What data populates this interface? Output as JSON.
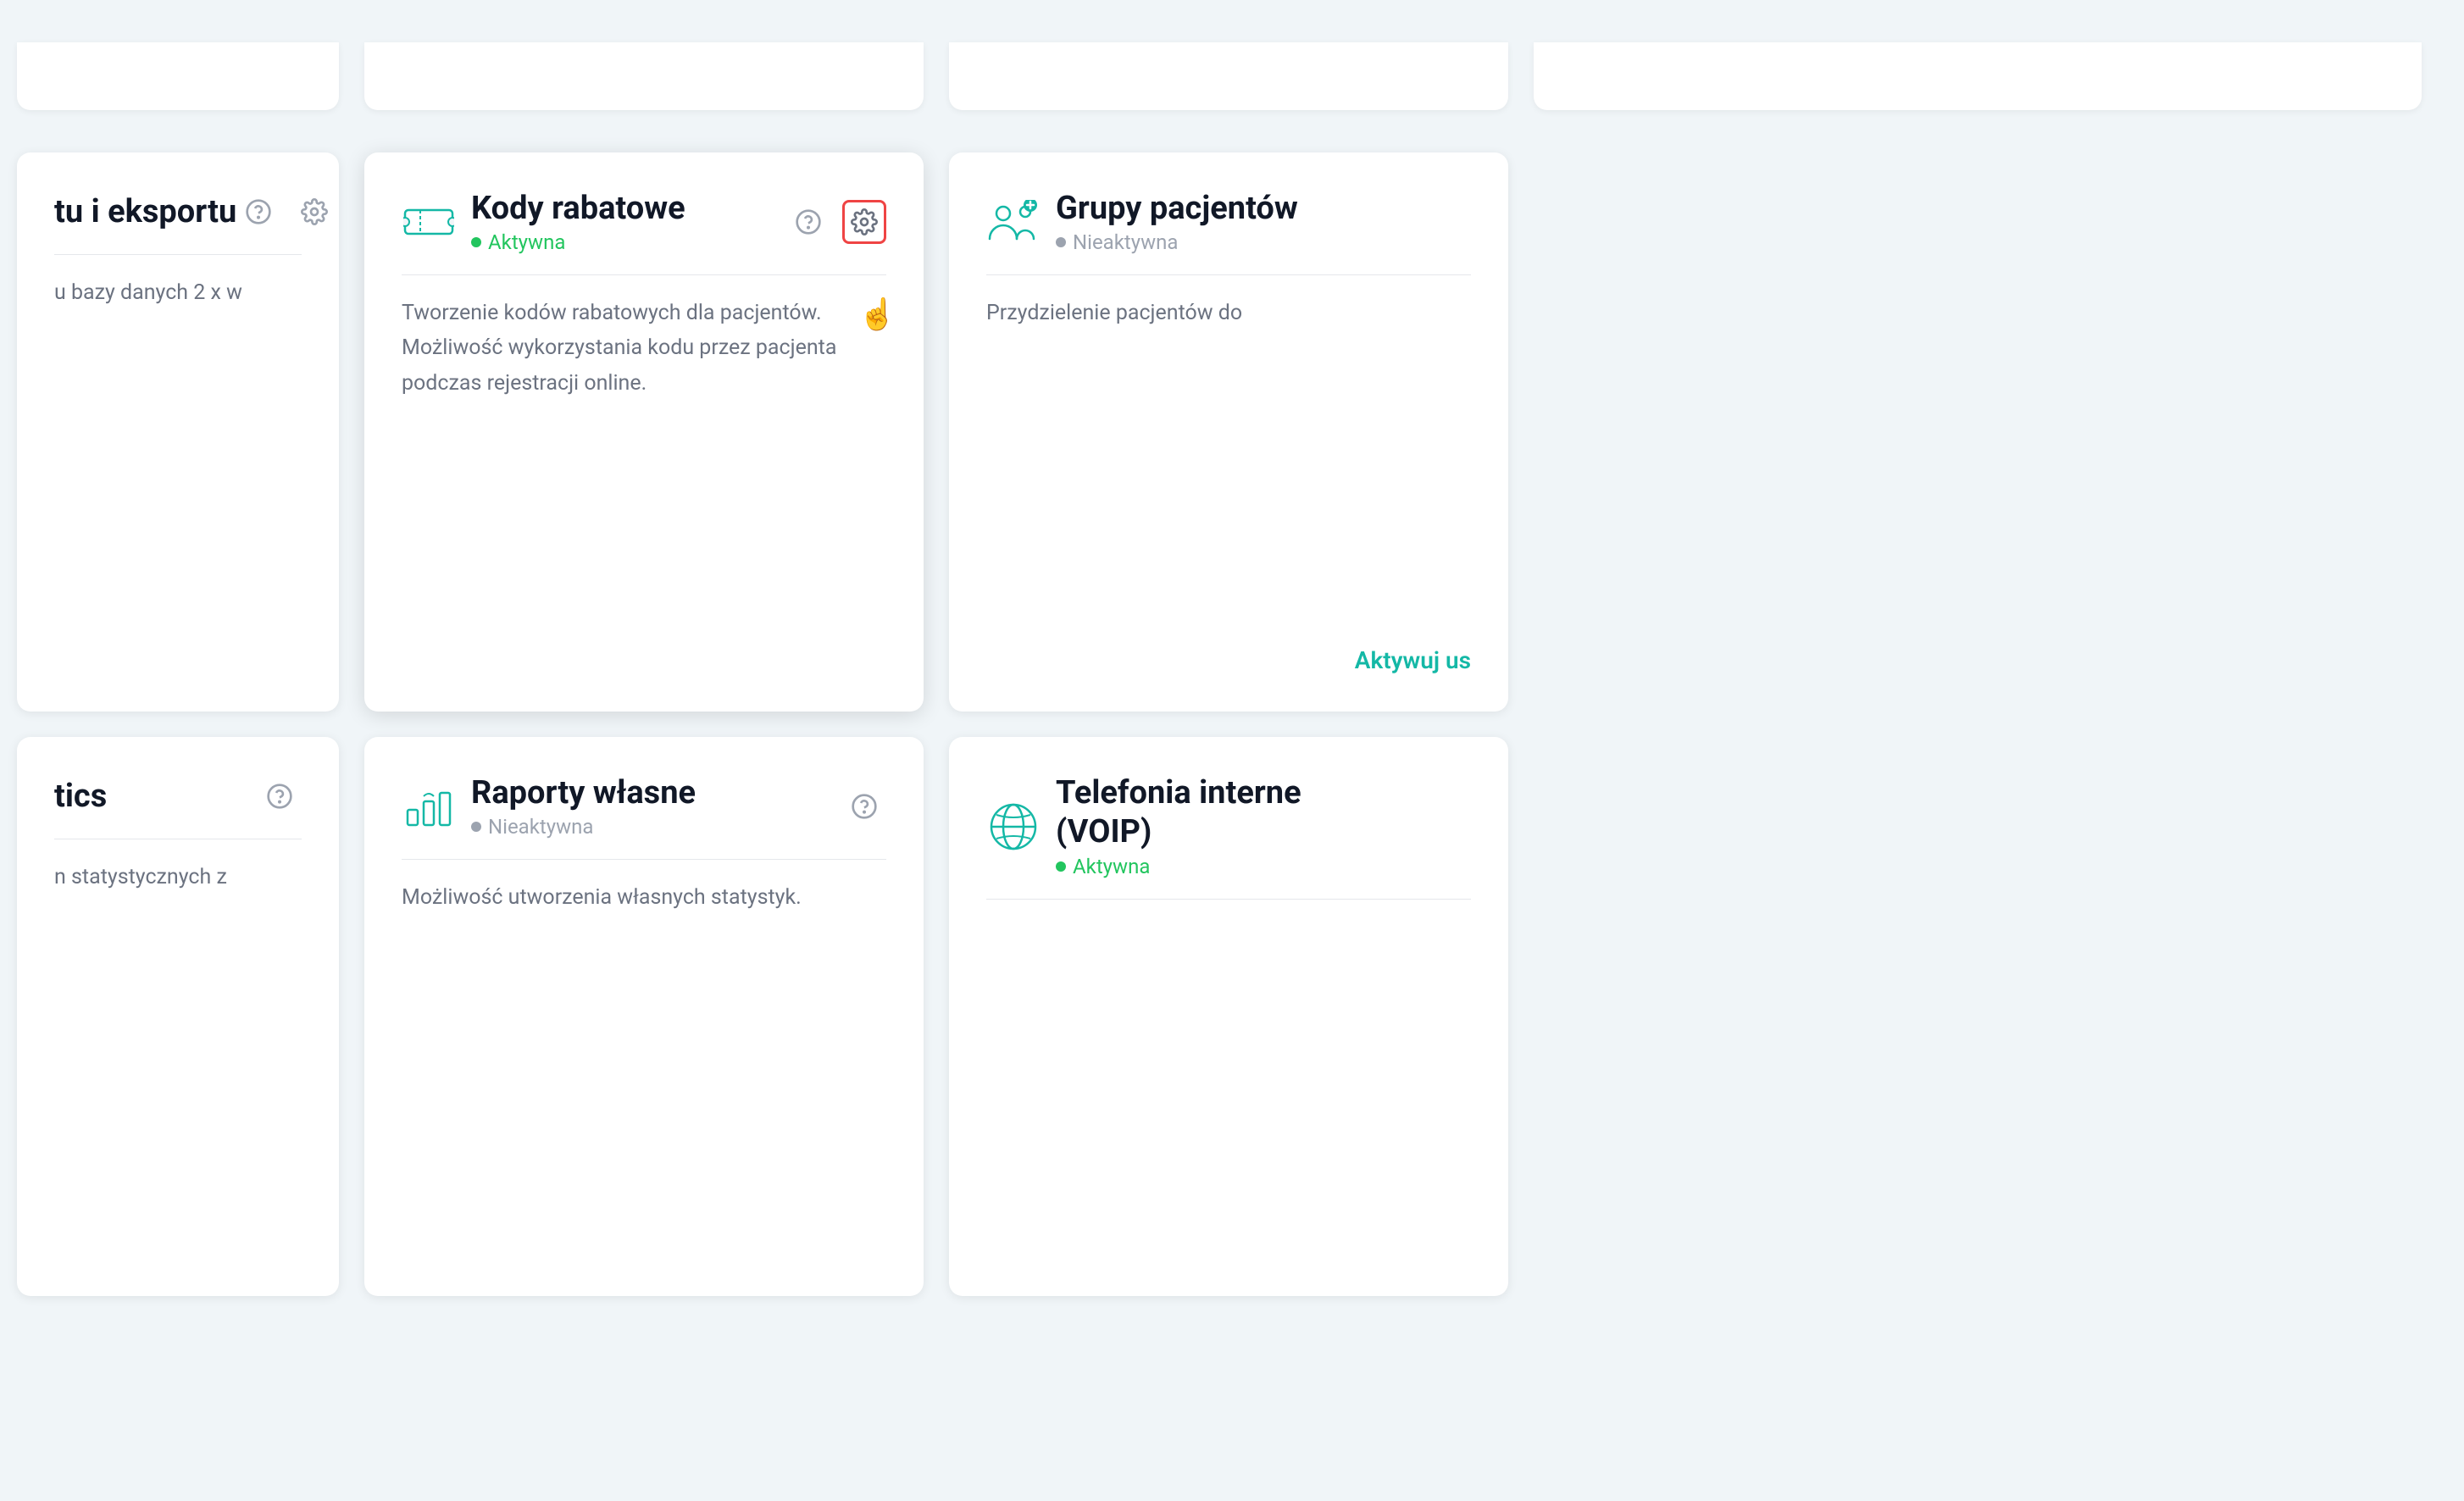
{
  "cards": {
    "top_row": {
      "card1": {
        "title": ""
      },
      "card2": {
        "title": ""
      },
      "card3": {
        "title": ""
      },
      "card4": {
        "title": ""
      }
    },
    "mid_left": {
      "title": "tu i eksportu",
      "status": "inactive",
      "status_label": "",
      "help": true,
      "settings": true,
      "description": "u bazy danych 2 x w"
    },
    "mid_center1": {
      "title": "Kody rabatowe",
      "status": "active",
      "status_label": "Aktywna",
      "help": true,
      "settings": true,
      "settings_highlighted": true,
      "description": "Tworzenie kodów rabatowych dla pacjentów. Możliwość wykorzystania kodu przez pacjenta podczas rejestracji online."
    },
    "mid_center2": {
      "title": "Grupy pacjentów",
      "status": "inactive",
      "status_label": "Nieaktywna",
      "help": false,
      "settings": false,
      "description": "Przydzielenie pacjentów do",
      "activate_link": "Aktywuj us"
    },
    "bot_left": {
      "title": "tics",
      "status": "inactive",
      "status_label": "",
      "help": true,
      "settings": false,
      "description": "n statystycznych z"
    },
    "bot_center1": {
      "title": "Raporty własne",
      "status": "inactive",
      "status_label": "Nieaktywna",
      "help": true,
      "settings": false,
      "description": "Możliwość utworzenia własnych statystyk."
    },
    "bot_center2": {
      "title": "Telefonia interne... (VOIP)",
      "title_line1": "Telefonia interne",
      "title_line2": "(VOIP)",
      "status": "active",
      "status_label": "Aktywna",
      "help": false,
      "settings": false,
      "description": ""
    }
  },
  "icons": {
    "kody_rabatowe": "ticket",
    "grupy_pacjentow": "group",
    "raporty_wlasne": "chart",
    "telefonia": "globe"
  },
  "colors": {
    "teal": "#14b8a6",
    "green": "#22c55e",
    "gray": "#9ca3af",
    "red": "#ef4444",
    "text_dark": "#111827",
    "text_gray": "#6b7280"
  }
}
